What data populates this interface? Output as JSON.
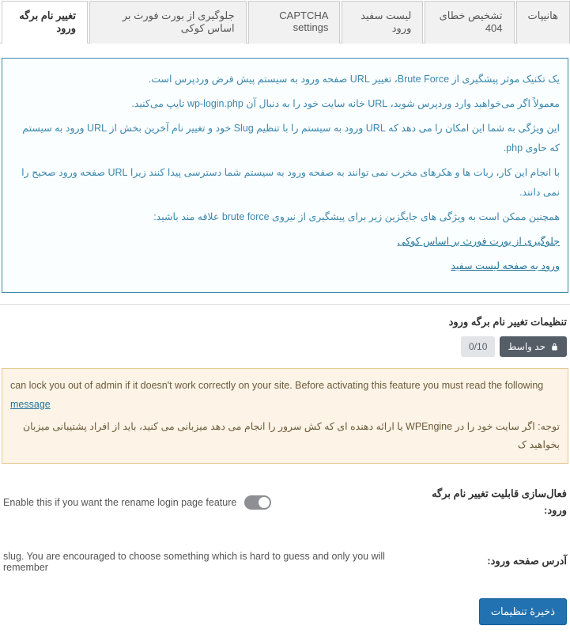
{
  "tabs": [
    {
      "label": "تغییر نام برگه ورود",
      "active": true
    },
    {
      "label": "جلوگیری از بورت فورث بر اساس کوکی",
      "active": false
    },
    {
      "label": "CAPTCHA settings",
      "active": false
    },
    {
      "label": "لیست سفید ورود",
      "active": false
    },
    {
      "label": "تشخیص خطای 404",
      "active": false
    },
    {
      "label": "هانیپات",
      "active": false
    }
  ],
  "info": {
    "p1": "یک تکنیک موثر پیشگیری از Brute Force، تغییر URL صفحه ورود به سیستم پیش فرض وردپرس است.",
    "p2": "معمولاً اگر می‌خواهید وارد وردپرس شوید، URL خانه سایت خود را به دنبال آن wp-login.php تایپ می‌کنید.",
    "p3": "این ویژگی به شما این امکان را می دهد که URL ورود به سیستم را با تنظیم Slug خود و تغییر نام آخرین بخش از URL ورود به سیستم که حاوی php.",
    "p4": "با انجام این کار، ربات ها و هکرهای مخرب نمی توانند به صفحه ورود به سیستم شما دسترسی پیدا کنند زیرا URL صفحه ورود صحیح را نمی دانند.",
    "p5": "همچنین ممکن است به ویژگی های جایگزین زیر برای پیشگیری از نیروی brute force علاقه مند باشید:",
    "link1": "جلوگیری از بورت فورث بر اساس کوکی",
    "link2": "ورود به صفحه لیست سفید"
  },
  "section_title": "تنظیمات تغییر نام برگه ورود",
  "badge": {
    "label": "حد واسط",
    "ratio": "0/10"
  },
  "warn": {
    "en_line": "can lock you out of admin if it doesn't work correctly on your site. Before activating this feature you must read the following",
    "en_link": "message",
    "fa_line": "توجه: اگر سایت خود را در WPEngine یا ارائه دهنده ای که کش سرور را انجام می دهد میزبانی می کنید، باید از افراد پشتیبانی میزبان بخواهید ک"
  },
  "form": {
    "enable_label": "فعال‌سازی قابلیت تغییر نام برگه ورود:",
    "enable_desc": "Enable this if you want the rename login page feature",
    "url_label": "آدرس صفحه ورود:",
    "url_desc": "slug. You are encouraged to choose something which is hard to guess and only you will remember"
  },
  "save_label": "ذخیرهٔ تنظیمات"
}
